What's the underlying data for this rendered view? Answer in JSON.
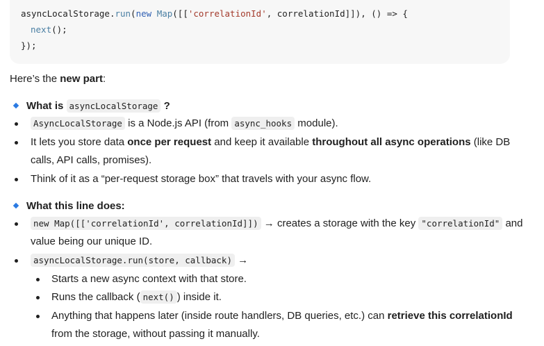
{
  "code": {
    "line1_fn": "asyncLocalStorage",
    "line1_dot": ".",
    "line1_method": "run",
    "line1_open": "(",
    "line1_new": "new",
    "line1_map": "Map",
    "line1_arr_open": "([[",
    "line1_key": "'correlationId'",
    "line1_rest": ", correlationId]]), () => {",
    "line2_next": "next",
    "line2_rest": "();",
    "line3": "});"
  },
  "intro": {
    "prefix": "Here’s the ",
    "bold": "new part",
    "suffix": ":"
  },
  "section1": {
    "heading_prefix": "What is ",
    "heading_code": "asyncLocalStorage",
    "heading_suffix": "?",
    "b1_code": "AsyncLocalStorage",
    "b1_mid": " is a Node.js API (from ",
    "b1_code2": "async_hooks",
    "b1_end": " module).",
    "b2_p1": "It lets you store data ",
    "b2_bold1": "once per request",
    "b2_p2": " and keep it available ",
    "b2_bold2": "throughout all async operations",
    "b2_p3": " (like DB",
    "b2_line2": "calls, API calls, promises).",
    "b3": "Think of it as a “per-request storage box” that travels with your async flow."
  },
  "section2": {
    "heading": "What this line does:",
    "b1_code": "new Map([['correlationId', correlationId]])",
    "b1_mid": " → creates a storage with the key ",
    "b1_code2": "\"correlationId\"",
    "b1_end": " and",
    "b1_line2": "value being our unique ID.",
    "b2_code": "asyncLocalStorage.run(store, callback)",
    "b2_arrow": " →",
    "sub1": "Starts a new async context with that store.",
    "sub2_prefix": "Runs the callback (",
    "sub2_code": "next()",
    "sub2_suffix": ") inside it.",
    "sub3_prefix": "Anything that happens later (inside route handlers, DB queries, etc.) can ",
    "sub3_bold": "retrieve this correlationId",
    "sub3_line2": "from the storage, without passing it manually."
  }
}
